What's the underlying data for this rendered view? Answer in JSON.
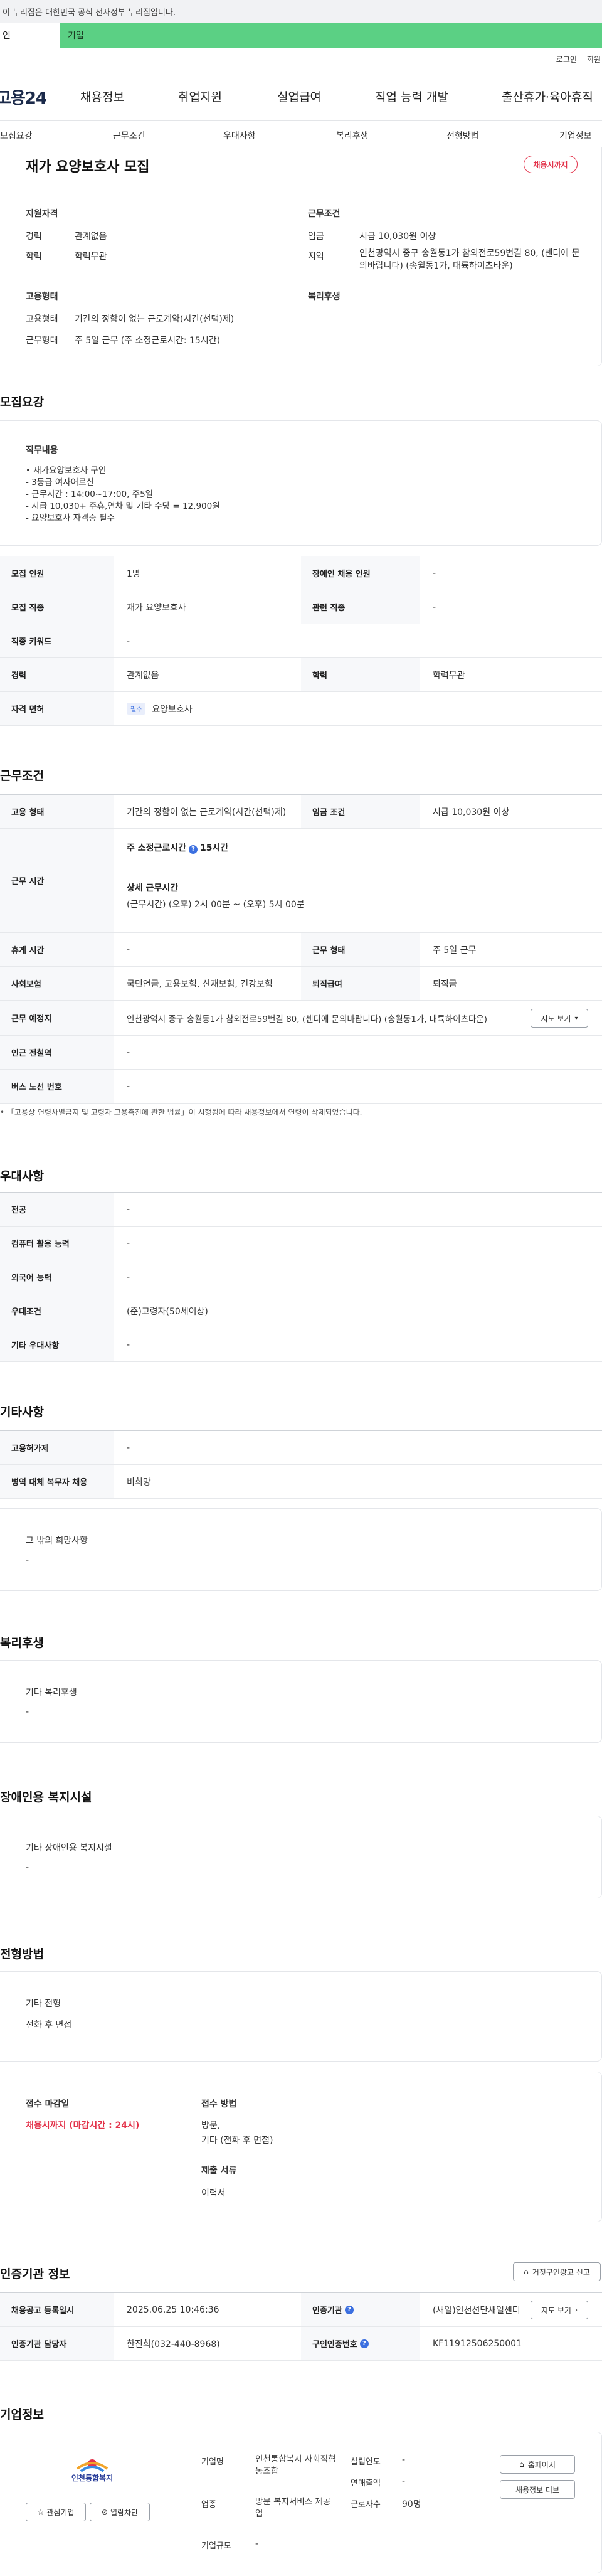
{
  "gov_banner": {
    "text": "이 누리집은 대한민국 공식 전자정부 누리집입니다."
  },
  "top_tabs": {
    "individual": "인",
    "business": "기업"
  },
  "util": {
    "login": "로그인",
    "join": "회원"
  },
  "gnb": {
    "logo": "고용24",
    "items": [
      "채용정보",
      "취업지원",
      "실업급여",
      "직업 능력 개발",
      "출산휴가·육아휴직"
    ]
  },
  "subnav": [
    "모집요강",
    "근무조건",
    "우대사항",
    "복리후생",
    "전형방법",
    "기업정보"
  ],
  "summary": {
    "title": "재가 요양보호사 모집",
    "status_badge": "채용시까지",
    "qual_head": "지원자격",
    "career_label": "경력",
    "career_value": "관계없음",
    "edu_label": "학력",
    "edu_value": "학력무관",
    "cond_head": "근무조건",
    "wage_label": "임금",
    "wage_value": "시급 10,030원 이상",
    "area_label": "지역",
    "area_value": "인천광역시 중구 송월동1가 참외전로59번길 80, (센터에 문의바랍니다) (송월동1가, 대륙하이츠타운)",
    "emp_head": "고용형태",
    "emp_type_label": "고용형태",
    "emp_type_value": "기간의 정함이 없는 근로계약(시간(선택)제)",
    "work_label": "근무형태",
    "work_value": "주 5일 근무 (주 소정근로시간: 15시간)",
    "welfare_head": "복리후생"
  },
  "recruit": {
    "section_title": "모집요강",
    "duty_head": "직무내용",
    "duty_lines": [
      "• 재가요양보호사 구인",
      "- 3등급 여자어르신",
      "- 근무시간 : 14:00~17:00, 주5일",
      "- 시급 10,030+ 주휴,연차 및 기타 수당 = 12,900원",
      "- 요양보호사 자격증 필수"
    ],
    "headcount_label": "모집 인원",
    "headcount_value": "1명",
    "disabled_label": "장애인 채용 인원",
    "disabled_value": "-",
    "job_label": "모집 직종",
    "job_value": "재가 요양보호사",
    "related_label": "관련 직종",
    "related_value": "-",
    "keyword_label": "직종 키워드",
    "keyword_value": "-",
    "career_label": "경력",
    "career_value": "관계없음",
    "edu_label": "학력",
    "edu_value": "학력무관",
    "license_label": "자격 면허",
    "license_badge": "필수",
    "license_value": "요양보호사"
  },
  "work": {
    "section_title": "근무조건",
    "emp_label": "고용 형태",
    "emp_value": "기간의 정함이 없는 근로계약(시간(선택)제)",
    "wage_label": "임금 조건",
    "wage_value": "시급 10,030원 이상",
    "hours_label": "근무 시간",
    "hours_weekly": "주 소정근로시간",
    "hours_weekly_value": "15시간",
    "hours_detail_head": "상세 근무시간",
    "hours_detail_value": "(근무시간) (오후) 2시 00분 ~ (오후) 5시 00분",
    "rest_label": "휴게 시간",
    "rest_value": "-",
    "form_label": "근무 형태",
    "form_value": "주 5일 근무",
    "insurance_label": "사회보험",
    "insurance_value": "국민연금, 고용보험, 산재보험, 건강보험",
    "severance_label": "퇴직급여",
    "severance_value": "퇴직금",
    "place_label": "근무 예정지",
    "place_value": "인천광역시 중구 송월동1가 참외전로59번길 80, (센터에 문의바랍니다) (송월동1가, 대륙하이츠타운)",
    "map_button": "지도 보기",
    "subway_label": "인근 전철역",
    "subway_value": "-",
    "bus_label": "버스 노선 번호",
    "bus_value": "-",
    "note": "「고용상 연령차별금지 및 고령자 고용촉진에 관한 법률」이 시행됨에 따라 채용정보에서 연령이 삭제되었습니다."
  },
  "pref": {
    "section_title": "우대사항",
    "major_label": "전공",
    "major_value": "-",
    "computer_label": "컴퓨터 활용 능력",
    "computer_value": "-",
    "lang_label": "외국어 능력",
    "lang_value": "-",
    "cond_label": "우대조건",
    "cond_value": "(준)고령자(50세이상)",
    "etc_label": "기타 우대사항",
    "etc_value": "-"
  },
  "misc": {
    "section_title": "기타사항",
    "permit_label": "고용허가제",
    "permit_value": "-",
    "military_label": "병역 대체 복무자 채용",
    "military_value": "비희망",
    "wish_head": "그 밖의 희망사항",
    "wish_value": "-"
  },
  "welfare": {
    "section_title": "복리후생",
    "head": "기타 복리후생",
    "value": "-"
  },
  "disability": {
    "section_title": "장애인용 복지시설",
    "head": "기타 장애인용 복지시설",
    "value": "-"
  },
  "screening": {
    "section_title": "전형방법",
    "other_head": "기타 전형",
    "other_value": "전화 후 면접",
    "deadline_head": "접수 마감일",
    "deadline_value": "채용시까지 (마감시간 : 24시)",
    "method_head": "접수 방법",
    "method_value1": "방문,",
    "method_value2": "기타 (전화 후 면접)",
    "docs_head": "제출 서류",
    "docs_value": "이력서"
  },
  "cert": {
    "section_title": "인증기관 정보",
    "report_button": "거짓구인광고 신고",
    "reg_label": "채용공고 등록일시",
    "reg_value": "2025.06.25 10:46:36",
    "agency_label": "인증기관",
    "agency_value": "(새일)인천선단새일센터",
    "map_button": "지도 보기",
    "manager_label": "인증기관 담당자",
    "manager_value": "한진희(032-440-8968)",
    "cert_no_label": "구인인증번호",
    "cert_no_value": "KF11912506250001"
  },
  "company": {
    "section_title": "기업정보",
    "logo_text": "인천통합복지",
    "fav_button": "관심기업",
    "block_button": "열람차단",
    "name_label": "기업명",
    "name_value": "인천통합복지 사회적협동조합",
    "founded_label": "설립연도",
    "founded_value": "-",
    "industry_label": "업종",
    "industry_value": "방문 복지서비스 제공업",
    "sales_label": "연매출액",
    "sales_value": "-",
    "employees_label": "근로자수",
    "employees_value": "90명",
    "size_label": "기업규모",
    "size_value": "-",
    "homepage_button": "홈페이지",
    "list_button": "채용정보 더보"
  },
  "colors": {
    "accent_green": "#5bd084",
    "badge_red": "#e3324a",
    "info_blue": "#3b6fe0"
  }
}
